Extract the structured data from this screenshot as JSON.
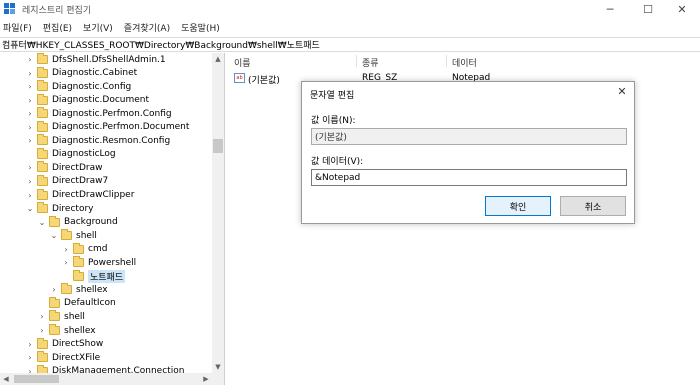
{
  "window": {
    "title": "레지스트리 편집기"
  },
  "menu": [
    "파일(F)",
    "편집(E)",
    "보기(V)",
    "즐겨찾기(A)",
    "도움말(H)"
  ],
  "address": "컴퓨터₩HKEY_CLASSES_ROOT₩Directory₩Background₩shell₩노트패드",
  "tree": [
    {
      "label": "DfsShell.DfsShellAdmin.1",
      "level": 0,
      "chevron": "›"
    },
    {
      "label": "Diagnostic.Cabinet",
      "level": 0,
      "chevron": "›"
    },
    {
      "label": "Diagnostic.Config",
      "level": 0,
      "chevron": "›"
    },
    {
      "label": "Diagnostic.Document",
      "level": 0,
      "chevron": "›"
    },
    {
      "label": "Diagnostic.Perfmon.Config",
      "level": 0,
      "chevron": "›"
    },
    {
      "label": "Diagnostic.Perfmon.Document",
      "level": 0,
      "chevron": "›"
    },
    {
      "label": "Diagnostic.Resmon.Config",
      "level": 0,
      "chevron": "›"
    },
    {
      "label": "DiagnosticLog",
      "level": 0,
      "chevron": ""
    },
    {
      "label": "DirectDraw",
      "level": 0,
      "chevron": "›"
    },
    {
      "label": "DirectDraw7",
      "level": 0,
      "chevron": "›"
    },
    {
      "label": "DirectDrawClipper",
      "level": 0,
      "chevron": "›"
    },
    {
      "label": "Directory",
      "level": 0,
      "chevron": "⌄"
    },
    {
      "label": "Background",
      "level": 1,
      "chevron": "⌄"
    },
    {
      "label": "shell",
      "level": 2,
      "chevron": "⌄"
    },
    {
      "label": "cmd",
      "level": 3,
      "chevron": "›"
    },
    {
      "label": "Powershell",
      "level": 3,
      "chevron": "›"
    },
    {
      "label": "노트패드",
      "level": 3,
      "chevron": "",
      "selected": true
    },
    {
      "label": "shellex",
      "level": 2,
      "chevron": "›"
    },
    {
      "label": "DefaultIcon",
      "level": 1,
      "chevron": ""
    },
    {
      "label": "shell",
      "level": 1,
      "chevron": "›"
    },
    {
      "label": "shellex",
      "level": 1,
      "chevron": "›"
    },
    {
      "label": "DirectShow",
      "level": 0,
      "chevron": "›"
    },
    {
      "label": "DirectXFile",
      "level": 0,
      "chevron": "›"
    },
    {
      "label": "DiskManagement.Connection",
      "level": 0,
      "chevron": "›"
    }
  ],
  "values_pane": {
    "columns": {
      "name": "이름",
      "type": "종류",
      "data": "데이터"
    },
    "rows": [
      {
        "name": "(기본값)",
        "type": "REG_SZ",
        "data": "Notepad",
        "icon": "ab"
      }
    ]
  },
  "dialog": {
    "title": "문자열 편집",
    "name_label": "값 이름(N):",
    "name_value": "(기본값)",
    "data_label": "값 데이터(V):",
    "data_value": "&Notepad",
    "ok_label": "확인",
    "cancel_label": "취소"
  },
  "colors": {
    "accent": "#0078d7",
    "selection": "#cce4f7",
    "folder": "#f5d77a"
  }
}
